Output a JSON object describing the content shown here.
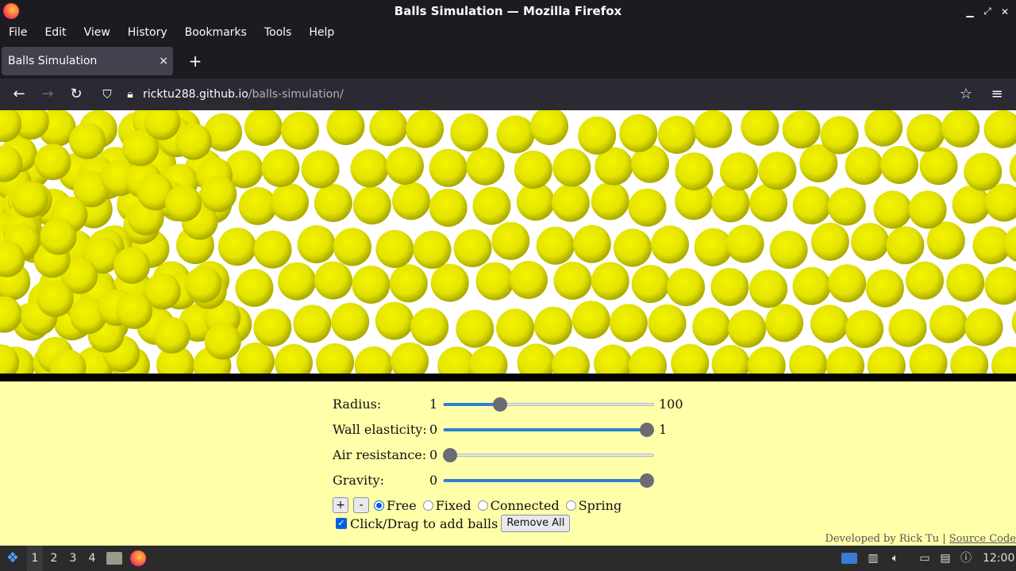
{
  "window": {
    "title": "Balls Simulation — Mozilla Firefox"
  },
  "menu": [
    "File",
    "Edit",
    "View",
    "History",
    "Bookmarks",
    "Tools",
    "Help"
  ],
  "tab": {
    "label": "Balls Simulation",
    "close": "×",
    "new_tab": "+"
  },
  "url": {
    "domain": "ricktu288.github.io",
    "path": "/balls-simulation/"
  },
  "simulation": {
    "ball_color": "#e6e600",
    "ball_edge": "#a8a800",
    "background": "#ffffff",
    "floor_color": "#000000"
  },
  "controls": {
    "radius": {
      "label": "Radius:",
      "min": "1",
      "max": "100",
      "fraction": 0.27
    },
    "wall_elasticity": {
      "label": "Wall elasticity:",
      "min": "0",
      "max": "1",
      "fraction": 0.97
    },
    "air_resistance": {
      "label": "Air resistance:",
      "min": "0",
      "max": "",
      "fraction": 0.03
    },
    "gravity": {
      "label": "Gravity:",
      "min": "0",
      "max": "",
      "fraction": 0.97
    },
    "add_button": "+",
    "remove_button": "-",
    "modes": [
      {
        "label": "Free",
        "checked": true
      },
      {
        "label": "Fixed",
        "checked": false
      },
      {
        "label": "Connected",
        "checked": false
      },
      {
        "label": "Spring",
        "checked": false
      }
    ],
    "click_drag_label": "Click/Drag to add balls",
    "click_drag_checked": true,
    "remove_all": "Remove All"
  },
  "credit": {
    "text": "Developed by Rick Tu |",
    "link": "Source Code"
  },
  "taskbar": {
    "workspaces": [
      "1",
      "2",
      "3",
      "4"
    ],
    "active_workspace": "1",
    "clock": "12:00"
  },
  "colors": {
    "panel": "#ffffaa",
    "slider_fill": "#2f7fd6",
    "accent": "#0060df"
  }
}
